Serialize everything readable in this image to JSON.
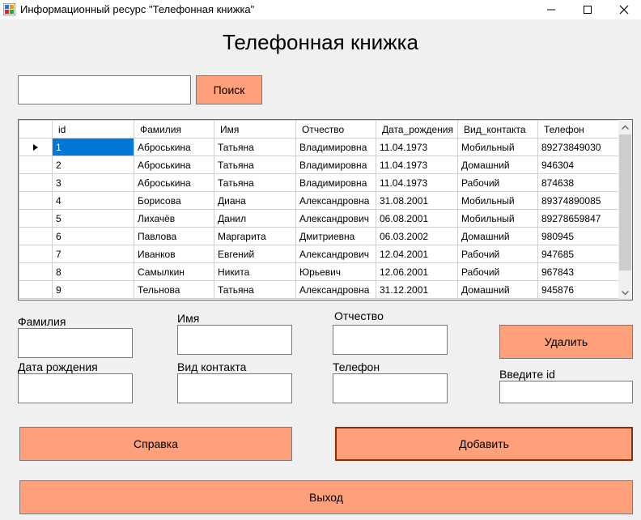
{
  "window": {
    "title": "Информационный ресурс \"Телефонная книжка\""
  },
  "heading": "Телефонная книжка",
  "search": {
    "value": "",
    "button_label": "Поиск"
  },
  "table": {
    "columns": [
      "id",
      "Фамилия",
      "Имя",
      "Отчество",
      "Дата_рождения",
      "Вид_контакта",
      "Телефон"
    ],
    "rows": [
      [
        "1",
        "Аброськина",
        "Татьяна",
        "Владимировна",
        "11.04.1973",
        "Мобильный",
        "89273849030"
      ],
      [
        "2",
        "Аброськина",
        "Татьяна",
        "Владимировна",
        "11.04.1973",
        "Домашний",
        "946304"
      ],
      [
        "3",
        "Аброськина",
        "Татьяна",
        "Владимировна",
        "11.04.1973",
        "Рабочий",
        "874638"
      ],
      [
        "4",
        "Борисова",
        "Диана",
        "Александровна",
        "31.08.2001",
        "Мобильный",
        "89374890085"
      ],
      [
        "5",
        "Лихачёв",
        "Данил",
        "Александрович",
        "06.08.2001",
        "Мобильный",
        "89278659847"
      ],
      [
        "6",
        "Павлова",
        "Маргарита",
        "Дмитриевна",
        "06.03.2002",
        "Домашний",
        "980945"
      ],
      [
        "7",
        "Иванков",
        "Евгений",
        "Александрович",
        "12.04.2001",
        "Рабочий",
        "947685"
      ],
      [
        "8",
        "Самылкин",
        "Никита",
        "Юрьевич",
        "12.06.2001",
        "Рабочий",
        "967843"
      ],
      [
        "9",
        "Тельнова",
        "Татьяна",
        "Александровна",
        "31.12.2001",
        "Домашний",
        "945876"
      ]
    ],
    "selected_row": 0
  },
  "form": {
    "surname_label": "Фамилия",
    "name_label": "Имя",
    "patronymic_label": "Отчество",
    "birthdate_label": "Дата рождения",
    "contact_type_label": "Вид контакта",
    "phone_label": "Телефон",
    "id_label": "Введите id"
  },
  "buttons": {
    "delete": "Удалить",
    "help": "Справка",
    "add": "Добавить",
    "exit": "Выход"
  },
  "colors": {
    "button_bg": "#ffa07a",
    "selection": "#0078d7"
  }
}
